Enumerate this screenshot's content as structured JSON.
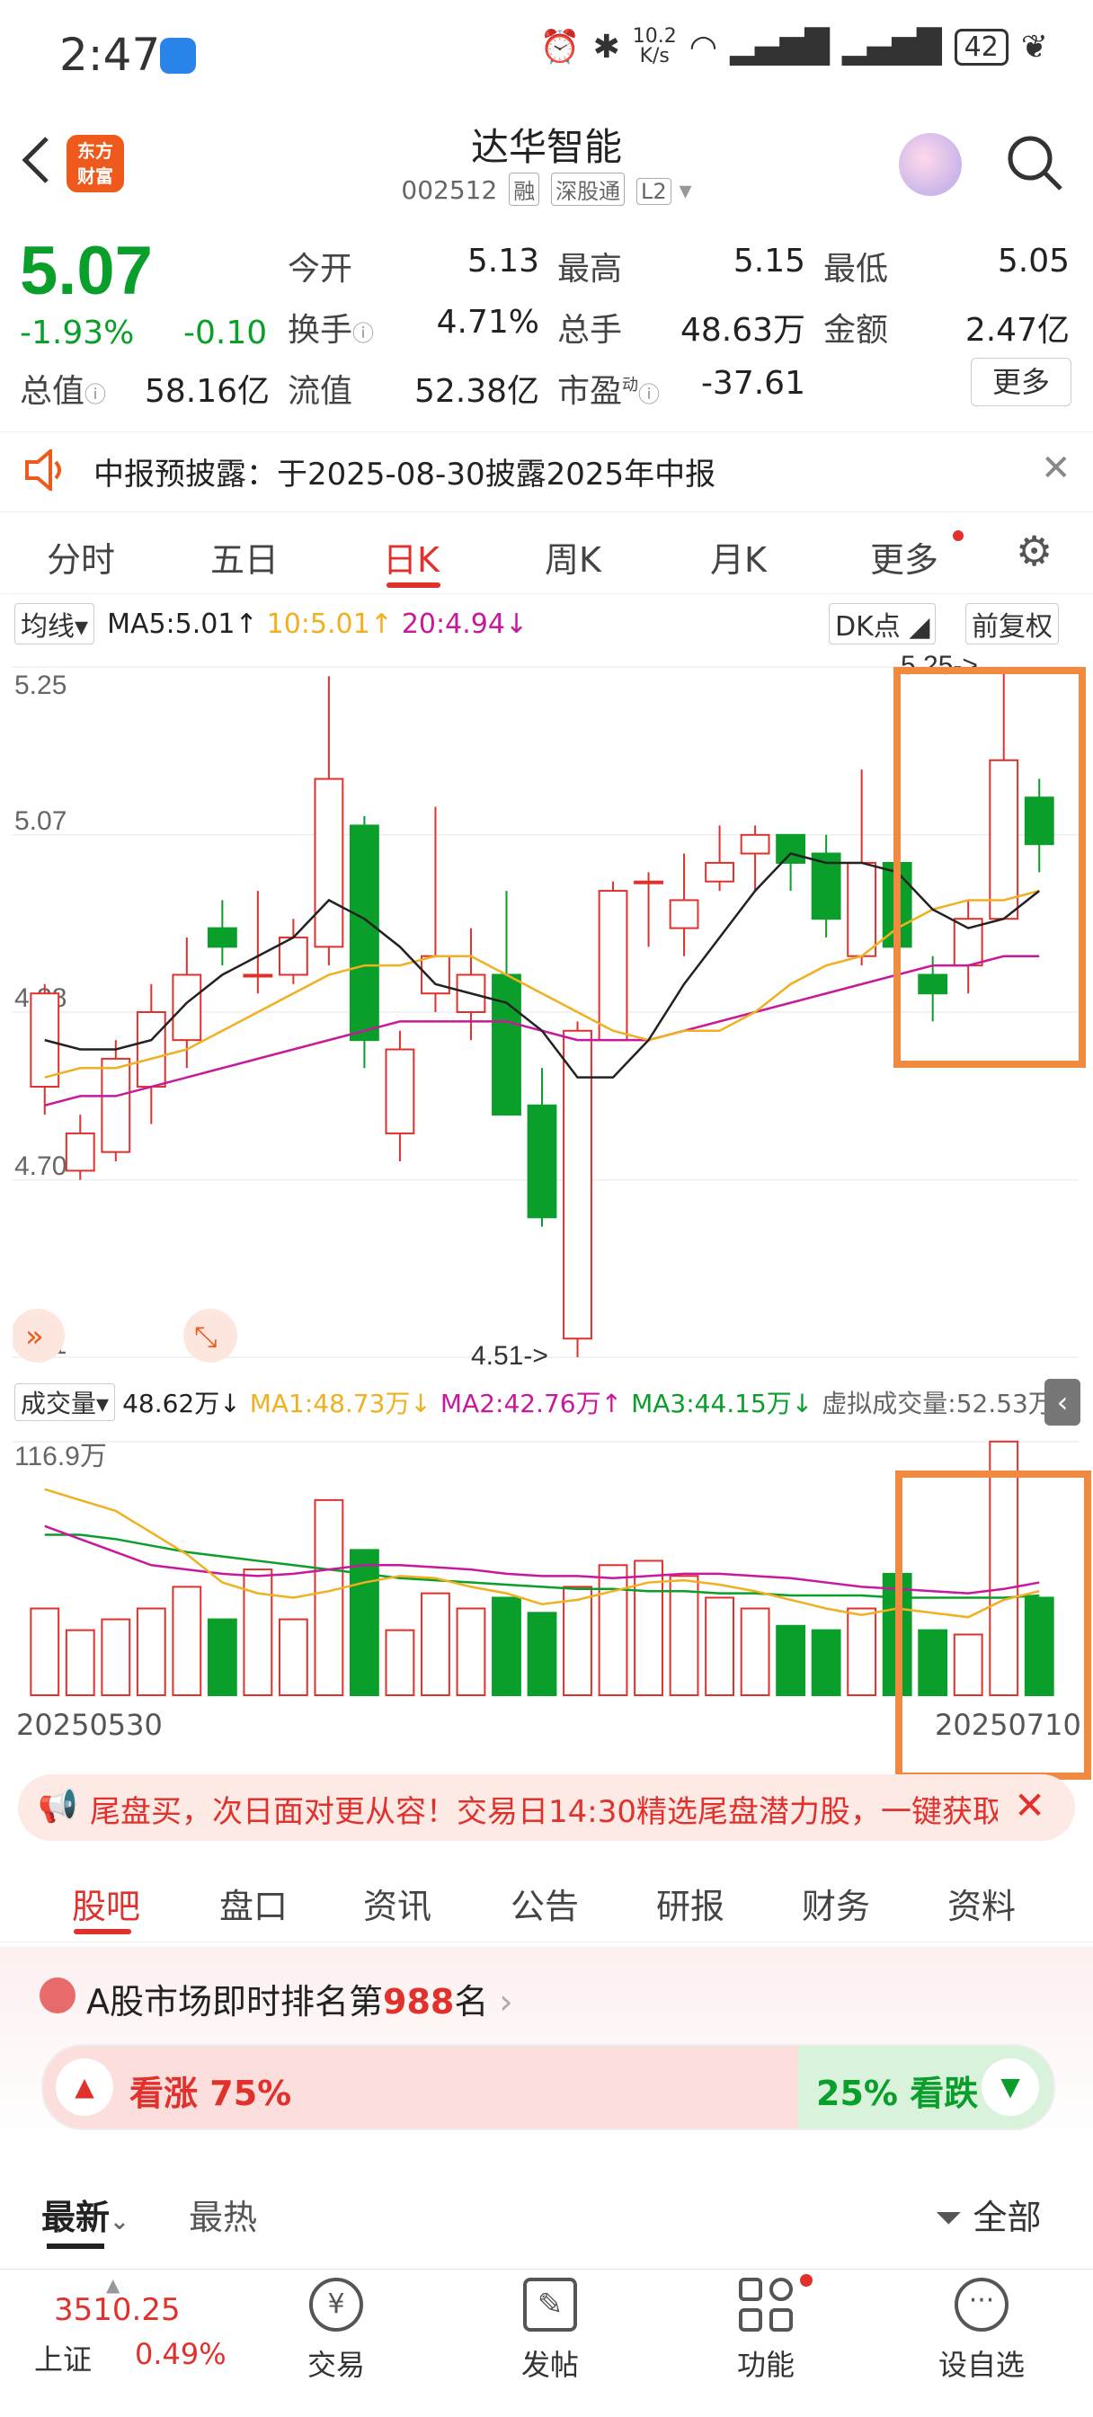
{
  "status": {
    "time": "2:47",
    "speed_top": "10.2",
    "speed_bottom": "K/s",
    "battery": "42"
  },
  "header": {
    "title": "达华智能",
    "code": "002512",
    "tags": [
      "融",
      "深股通",
      "L2"
    ],
    "logo_line1": "东方",
    "logo_line2": "财富"
  },
  "quote": {
    "price": "5.07",
    "change_pct": "-1.93%",
    "change": "-0.10",
    "fields": [
      {
        "label": "今开",
        "value": "5.13",
        "color": "red"
      },
      {
        "label": "最高",
        "value": "5.15",
        "color": "red"
      },
      {
        "label": "最低",
        "value": "5.05",
        "color": "green"
      },
      {
        "label": "换手",
        "value": "4.71%",
        "color": "dark"
      },
      {
        "label": "总手",
        "value": "48.63万",
        "color": "dark"
      },
      {
        "label": "金额",
        "value": "2.47亿",
        "color": "dark"
      },
      {
        "label": "总值",
        "value": "58.16亿",
        "color": "dark"
      },
      {
        "label": "流值",
        "value": "52.38亿",
        "color": "dark"
      },
      {
        "label": "市盈",
        "value": "-37.61",
        "color": "dark"
      }
    ],
    "pe_sup": "动",
    "more": "更多"
  },
  "notice": {
    "text": "中报预披露：于2025-08-30披露2025年中报"
  },
  "ktabs": [
    "分时",
    "五日",
    "日K",
    "周K",
    "月K",
    "更多"
  ],
  "ma": {
    "label": "均线",
    "ma5": "MA5:5.01↑",
    "ma10": "10:5.01↑",
    "ma20": "20:4.94↓",
    "dk": "DK点",
    "fq": "前复权"
  },
  "vol_header": {
    "label": "成交量",
    "vol": "48.62万↓",
    "ma1": "MA1:48.73万↓",
    "ma2": "MA2:42.76万↑",
    "ma3": "MA3:44.15万↓",
    "virtual": "虚拟成交量:52.53万"
  },
  "chart_data": {
    "type": "candlestick",
    "y_ticks": [
      "5.25",
      "5.07",
      "4.88",
      "4.70",
      "4.51"
    ],
    "ylim": [
      4.51,
      5.25
    ],
    "high_label": "5.25->",
    "low_label": "4.51->",
    "candles": [
      {
        "o": 4.8,
        "c": 4.9,
        "h": 4.91,
        "l": 4.77
      },
      {
        "o": 4.71,
        "c": 4.75,
        "h": 4.77,
        "l": 4.7
      },
      {
        "o": 4.73,
        "c": 4.83,
        "h": 4.85,
        "l": 4.72
      },
      {
        "o": 4.8,
        "c": 4.88,
        "h": 4.91,
        "l": 4.76
      },
      {
        "o": 4.85,
        "c": 4.92,
        "h": 4.96,
        "l": 4.82
      },
      {
        "o": 4.97,
        "c": 4.95,
        "h": 5.0,
        "l": 4.93
      },
      {
        "o": 4.92,
        "c": 4.92,
        "h": 5.01,
        "l": 4.9
      },
      {
        "o": 4.92,
        "c": 4.96,
        "h": 4.98,
        "l": 4.91
      },
      {
        "o": 4.95,
        "c": 5.13,
        "h": 5.24,
        "l": 4.93
      },
      {
        "o": 5.08,
        "c": 4.85,
        "h": 5.09,
        "l": 4.82
      },
      {
        "o": 4.75,
        "c": 4.84,
        "h": 4.86,
        "l": 4.72
      },
      {
        "o": 4.9,
        "c": 4.94,
        "h": 5.1,
        "l": 4.88
      },
      {
        "o": 4.88,
        "c": 4.92,
        "h": 4.97,
        "l": 4.85
      },
      {
        "o": 4.92,
        "c": 4.77,
        "h": 5.01,
        "l": 4.77
      },
      {
        "o": 4.78,
        "c": 4.66,
        "h": 4.82,
        "l": 4.65
      },
      {
        "o": 4.53,
        "c": 4.86,
        "h": 4.87,
        "l": 4.51
      },
      {
        "o": 4.85,
        "c": 5.01,
        "h": 5.02,
        "l": 4.85
      },
      {
        "o": 5.02,
        "c": 5.02,
        "h": 5.03,
        "l": 4.95
      },
      {
        "o": 4.97,
        "c": 5.0,
        "h": 5.05,
        "l": 4.94
      },
      {
        "o": 5.02,
        "c": 5.04,
        "h": 5.08,
        "l": 5.01
      },
      {
        "o": 5.05,
        "c": 5.07,
        "h": 5.08,
        "l": 5.01
      },
      {
        "o": 5.07,
        "c": 5.04,
        "h": 5.07,
        "l": 5.01
      },
      {
        "o": 5.05,
        "c": 4.98,
        "h": 5.07,
        "l": 4.96
      },
      {
        "o": 4.94,
        "c": 5.04,
        "h": 5.14,
        "l": 4.93
      },
      {
        "o": 5.04,
        "c": 4.95,
        "h": 5.1,
        "l": 4.95
      },
      {
        "o": 4.92,
        "c": 4.9,
        "h": 4.94,
        "l": 4.87
      },
      {
        "o": 4.93,
        "c": 4.98,
        "h": 5.0,
        "l": 4.9
      },
      {
        "o": 4.98,
        "c": 5.15,
        "h": 5.25,
        "l": 4.98
      },
      {
        "o": 5.11,
        "c": 5.06,
        "h": 5.13,
        "l": 5.03
      }
    ],
    "ma5": [
      4.85,
      4.84,
      4.84,
      4.85,
      4.89,
      4.92,
      4.94,
      4.96,
      5.0,
      4.98,
      4.95,
      4.91,
      4.9,
      4.89,
      4.86,
      4.81,
      4.81,
      4.85,
      4.91,
      4.96,
      5.01,
      5.05,
      5.04,
      5.04,
      5.03,
      4.99,
      4.97,
      4.98,
      5.01
    ],
    "ma10": [
      4.81,
      4.82,
      4.82,
      4.83,
      4.84,
      4.86,
      4.88,
      4.9,
      4.92,
      4.93,
      4.93,
      4.94,
      4.94,
      4.92,
      4.9,
      4.88,
      4.86,
      4.85,
      4.86,
      4.86,
      4.88,
      4.91,
      4.93,
      4.94,
      4.97,
      4.99,
      5.0,
      5.0,
      5.01
    ],
    "ma20": [
      4.78,
      4.79,
      4.79,
      4.8,
      4.81,
      4.82,
      4.83,
      4.84,
      4.85,
      4.86,
      4.87,
      4.87,
      4.87,
      4.87,
      4.86,
      4.85,
      4.85,
      4.85,
      4.86,
      4.87,
      4.88,
      4.89,
      4.9,
      4.91,
      4.92,
      4.93,
      4.93,
      4.94,
      4.94
    ],
    "volume": {
      "ylim_max_label": "116.9万",
      "ymax": 116.9,
      "values": [
        40,
        30,
        35,
        40,
        50,
        35,
        58,
        35,
        90,
        67,
        30,
        47,
        40,
        45,
        38,
        50,
        60,
        62,
        55,
        45,
        40,
        32,
        30,
        40,
        56,
        30,
        28,
        117,
        45
      ],
      "ma1": [
        95,
        90,
        85,
        75,
        65,
        52,
        47,
        45,
        48,
        52,
        55,
        54,
        50,
        47,
        42,
        44,
        48,
        52,
        53,
        51,
        48,
        44,
        40,
        37,
        40,
        38,
        36,
        44,
        48
      ],
      "ma2": [
        78,
        72,
        66,
        60,
        58,
        56,
        55,
        56,
        58,
        60,
        60,
        59,
        58,
        56,
        55,
        55,
        54,
        55,
        56,
        56,
        55,
        54,
        52,
        50,
        49,
        48,
        47,
        49,
        52
      ],
      "ma3": [
        74,
        74,
        72,
        69,
        66,
        64,
        62,
        60,
        58,
        56,
        54,
        53,
        52,
        51,
        50,
        49,
        49,
        48,
        48,
        47,
        47,
        46,
        46,
        46,
        45,
        45,
        45,
        45,
        46
      ]
    },
    "x_start": "20250530",
    "x_end": "20250710"
  },
  "colors": {
    "up": "#e0312d",
    "down": "#0a9e2a",
    "ma5": "#222222",
    "ma10": "#f0b020",
    "ma20": "#c8199c",
    "highlight": "#f08a40"
  },
  "banner": {
    "text": "尾盘买，次日面对更从容！交易日14:30精选尾盘潜力股，一键获取"
  },
  "subtabs": [
    "股吧",
    "盘口",
    "资讯",
    "公告",
    "研报",
    "财务",
    "资料"
  ],
  "rank": {
    "prefix": "A股市场即时排名第",
    "num": "988",
    "suffix": "名"
  },
  "vote": {
    "up_label": "看涨",
    "up_pct": "75%",
    "down_pct": "25%",
    "down_label": "看跌"
  },
  "sort": {
    "latest": "最新",
    "hot": "最热",
    "filter": "全部"
  },
  "bottomnav": {
    "index_value": "3510.25",
    "index_name": "上证",
    "index_change": "0.49%",
    "items": [
      "交易",
      "发帖",
      "功能",
      "设自选"
    ]
  }
}
